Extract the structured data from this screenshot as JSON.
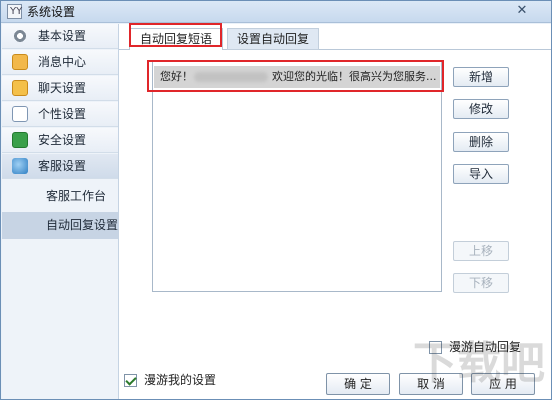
{
  "window": {
    "title": "系统设置",
    "app_icon": "YY",
    "close_icon": "close-icon"
  },
  "sidebar": {
    "items": [
      {
        "label": "基本设置",
        "icon": "gear-icon"
      },
      {
        "label": "消息中心",
        "icon": "mail-icon"
      },
      {
        "label": "聊天设置",
        "icon": "chat-icon"
      },
      {
        "label": "个性设置",
        "icon": "personalize-icon"
      },
      {
        "label": "安全设置",
        "icon": "shield-icon"
      },
      {
        "label": "客服设置",
        "icon": "customer-service-icon"
      }
    ],
    "sub_items": [
      {
        "label": "客服工作台"
      },
      {
        "label": "自动回复设置"
      }
    ]
  },
  "tabs": [
    {
      "label": "自动回复短语",
      "selected": true
    },
    {
      "label": "设置自动回复",
      "selected": false
    }
  ],
  "reply_list": {
    "rows": [
      {
        "prefix": "您好！",
        "suffix": "欢迎您的光临！很高兴为您服务..."
      }
    ]
  },
  "actions": {
    "add": "新增",
    "edit": "修改",
    "delete": "删除",
    "import": "导入",
    "move_up": "上移",
    "move_down": "下移"
  },
  "options": {
    "roam_auto_reply": {
      "label": "漫游自动回复",
      "checked": false
    },
    "roam_my_settings": {
      "label": "漫游我的设置",
      "checked": true
    }
  },
  "footer": {
    "ok": "确 定",
    "cancel": "取 消",
    "apply": "应 用"
  },
  "watermark": {
    "text": "下载吧"
  },
  "colors": {
    "highlight": "#e0262a",
    "accent": "#6b8fb6"
  }
}
